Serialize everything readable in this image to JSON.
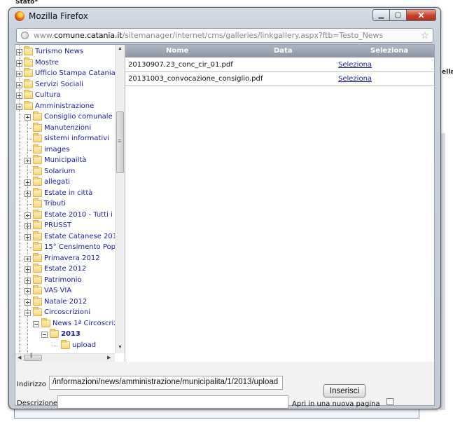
{
  "background": {
    "stato_label": "Stato*",
    "side_fragment": "ella"
  },
  "window": {
    "title": "Mozilla Firefox",
    "minimize_glyph": "▁",
    "maximize_glyph": "▢",
    "close_glyph": "✕"
  },
  "url": {
    "prefix": "www.",
    "domain": "comune.catania.it",
    "path": "/sitemanager/internet/cms/galleries/linkgallery.aspx?ftb=Testo_News",
    "globe_icon": "globe-icon",
    "star_icon": "☆"
  },
  "tree": {
    "items": [
      {
        "label": "Turismo News"
      },
      {
        "label": "Mostre"
      },
      {
        "label": "Ufficio Stampa Catania"
      },
      {
        "label": "Servizi Sociali"
      },
      {
        "label": "Cultura"
      },
      {
        "label": "Amministrazione"
      },
      {
        "label": "Consiglio comunale"
      },
      {
        "label": "Manutenzioni"
      },
      {
        "label": "sistemi informativi"
      },
      {
        "label": "images"
      },
      {
        "label": "Municipailtà"
      },
      {
        "label": "Solarium"
      },
      {
        "label": "allegati"
      },
      {
        "label": "Estate in città"
      },
      {
        "label": "Tributi"
      },
      {
        "label": "Estate 2010 - Tutti i"
      },
      {
        "label": "PRUSST"
      },
      {
        "label": "Estate Catanese 201"
      },
      {
        "label": "15° Censimento Pop"
      },
      {
        "label": "Primavera 2012"
      },
      {
        "label": "Estate 2012"
      },
      {
        "label": "Patrimonio"
      },
      {
        "label": "VAS VIA"
      },
      {
        "label": "Natale 2012"
      },
      {
        "label": "Circoscrizioni"
      },
      {
        "label": "News 1ª Circoscriz"
      },
      {
        "label": "2013"
      },
      {
        "label": "upload"
      }
    ]
  },
  "files": {
    "headers": {
      "name": "Nome",
      "date": "Data",
      "select": "Seleziona"
    },
    "rows": [
      {
        "name": "20130907.23_conc_cir_01.pdf",
        "date": "",
        "select": "Seleziona"
      },
      {
        "name": "20131003_convocazione_consiglio.pdf",
        "date": "",
        "select": "Seleziona"
      }
    ]
  },
  "form": {
    "indirizzo_label": "Indirizzo",
    "indirizzo_value": "/informazioni/news/amministrazione/municipalita/1/2013/upload",
    "descrizione_label": "Descrizione",
    "descrizione_value": "",
    "inserisci_label": "Inserisci",
    "new_page_label": "Apri in una nuova pagina",
    "new_page_checked": false
  }
}
